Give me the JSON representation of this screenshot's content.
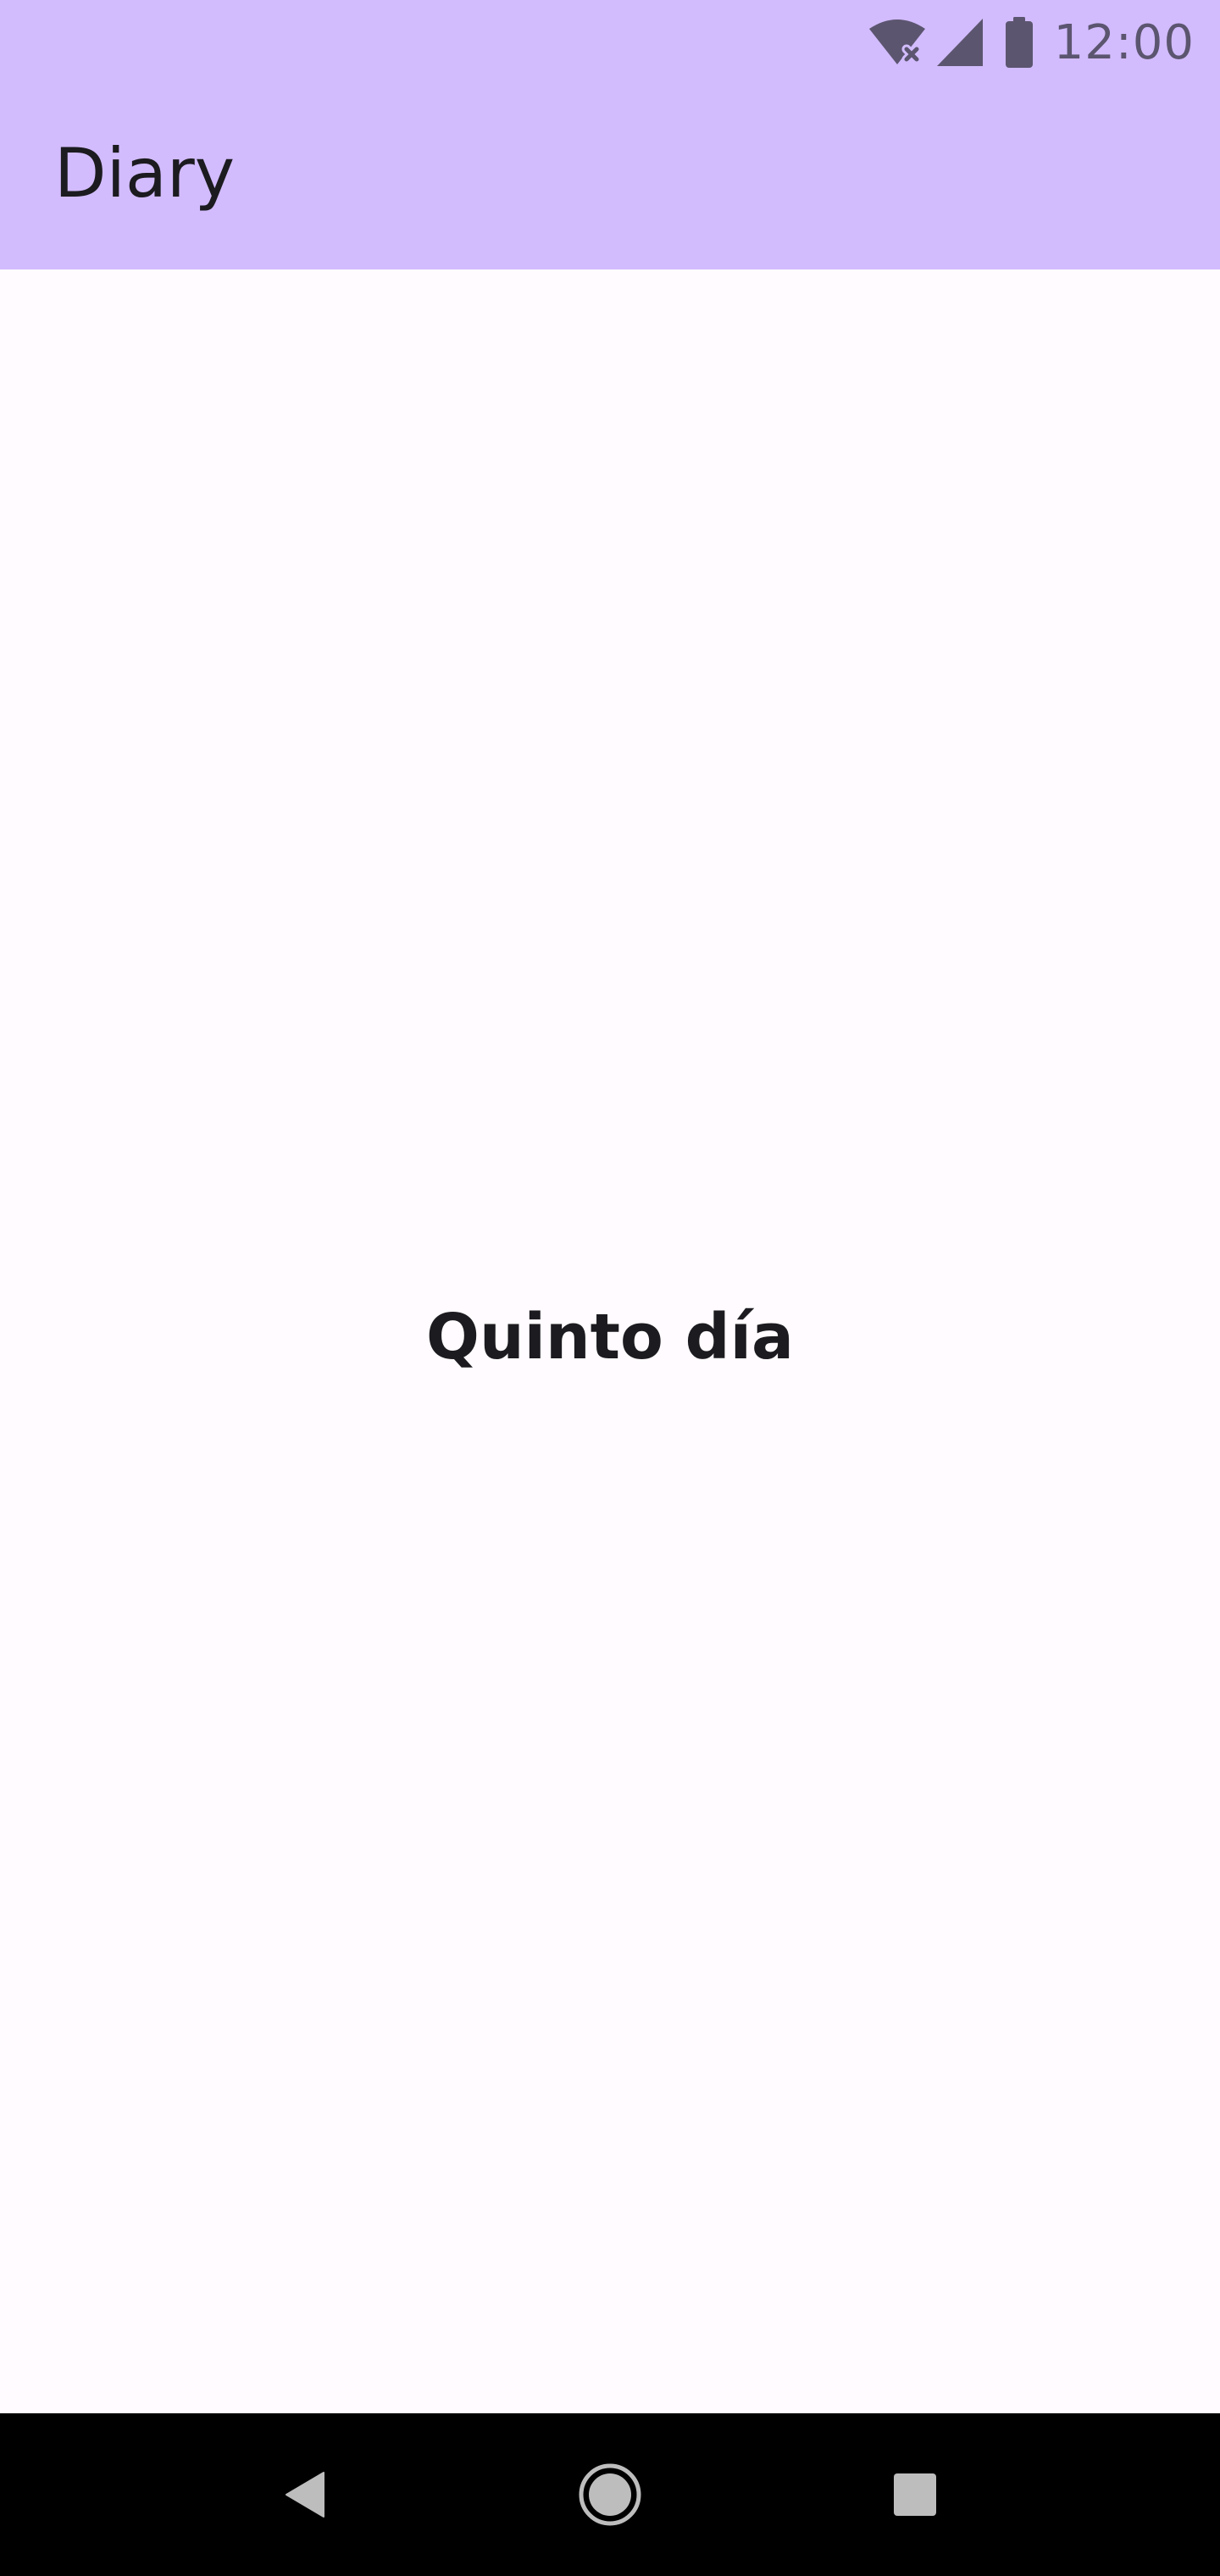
{
  "status_bar": {
    "time": "12:00",
    "icons": [
      "wifi-off-icon",
      "cellular-signal-icon",
      "battery-icon"
    ]
  },
  "app_bar": {
    "title": "Diary"
  },
  "content": {
    "entry_title": "Quinto día"
  },
  "navigation": {
    "buttons": [
      "back-icon",
      "home-icon",
      "recents-icon"
    ]
  },
  "colors": {
    "app_bar_background": "#D2BCFD",
    "page_background": "#FFFBFE",
    "status_icon": "#5C5570",
    "text": "#1C1B1F",
    "nav_bar_background": "#000000",
    "nav_icon": "#BDBDBD"
  }
}
